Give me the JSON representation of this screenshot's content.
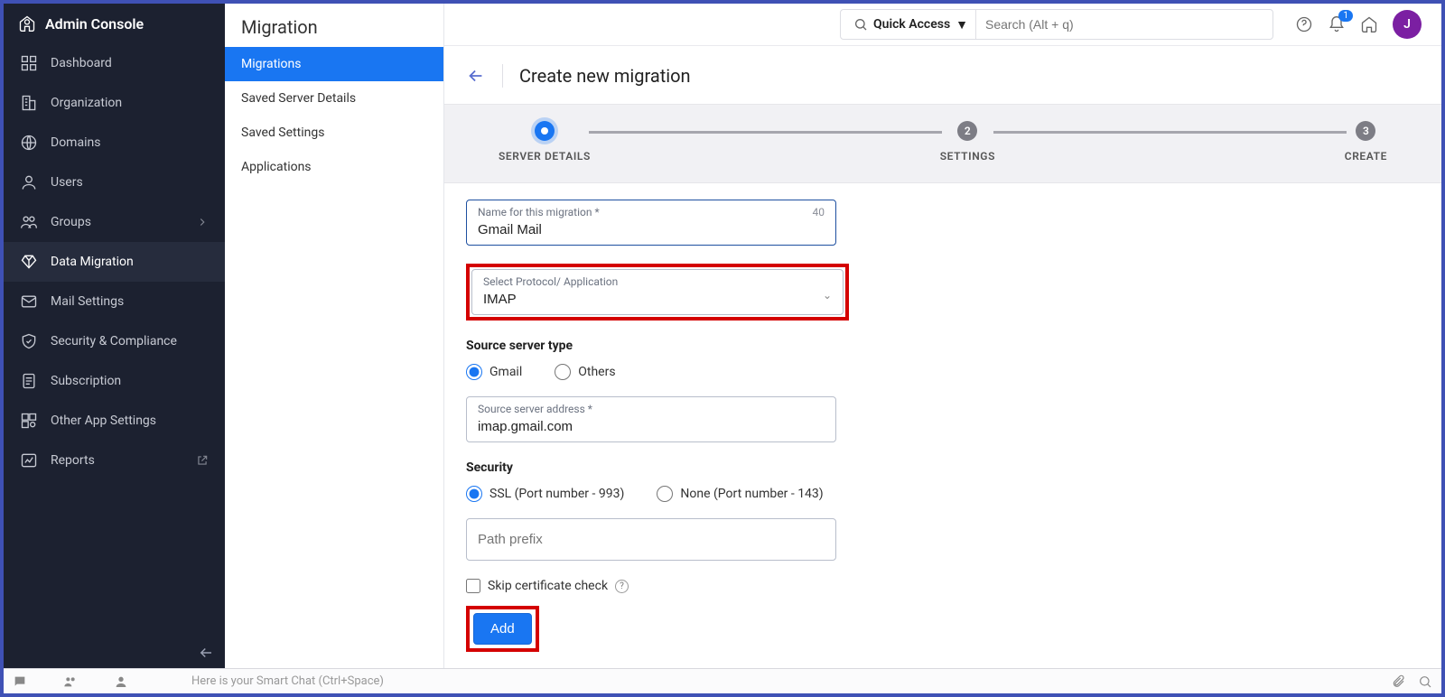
{
  "app_title": "Admin Console",
  "sidebar": {
    "items": [
      {
        "label": "Dashboard"
      },
      {
        "label": "Organization"
      },
      {
        "label": "Domains"
      },
      {
        "label": "Users"
      },
      {
        "label": "Groups"
      },
      {
        "label": "Data Migration"
      },
      {
        "label": "Mail Settings"
      },
      {
        "label": "Security & Compliance"
      },
      {
        "label": "Subscription"
      },
      {
        "label": "Other App Settings"
      },
      {
        "label": "Reports"
      }
    ]
  },
  "subpanel": {
    "title": "Migration",
    "items": [
      {
        "label": "Migrations"
      },
      {
        "label": "Saved Server Details"
      },
      {
        "label": "Saved Settings"
      },
      {
        "label": "Applications"
      }
    ]
  },
  "topbar": {
    "quick_access": "Quick Access",
    "search_placeholder": "Search (Alt + q)",
    "badge_count": "1",
    "avatar_letter": "J"
  },
  "page": {
    "title": "Create new migration"
  },
  "stepper": {
    "steps": [
      {
        "label": "SERVER DETAILS"
      },
      {
        "label": "SETTINGS",
        "num": "2"
      },
      {
        "label": "CREATE",
        "num": "3"
      }
    ]
  },
  "form": {
    "name_label": "Name for this migration *",
    "name_value": "Gmail Mail",
    "name_counter": "40",
    "protocol_label": "Select Protocol/ Application",
    "protocol_value": "IMAP",
    "source_type_label": "Source server type",
    "source_type_options": {
      "gmail": "Gmail",
      "others": "Others"
    },
    "source_addr_label": "Source server address *",
    "source_addr_value": "imap.gmail.com",
    "security_label": "Security",
    "security_options": {
      "ssl": "SSL (Port number - 993)",
      "none": "None (Port number - 143)"
    },
    "path_prefix_placeholder": "Path prefix",
    "skip_cert_label": "Skip certificate check",
    "add_btn": "Add"
  },
  "bottombar": {
    "smartchat": "Here is your Smart Chat (Ctrl+Space)"
  }
}
